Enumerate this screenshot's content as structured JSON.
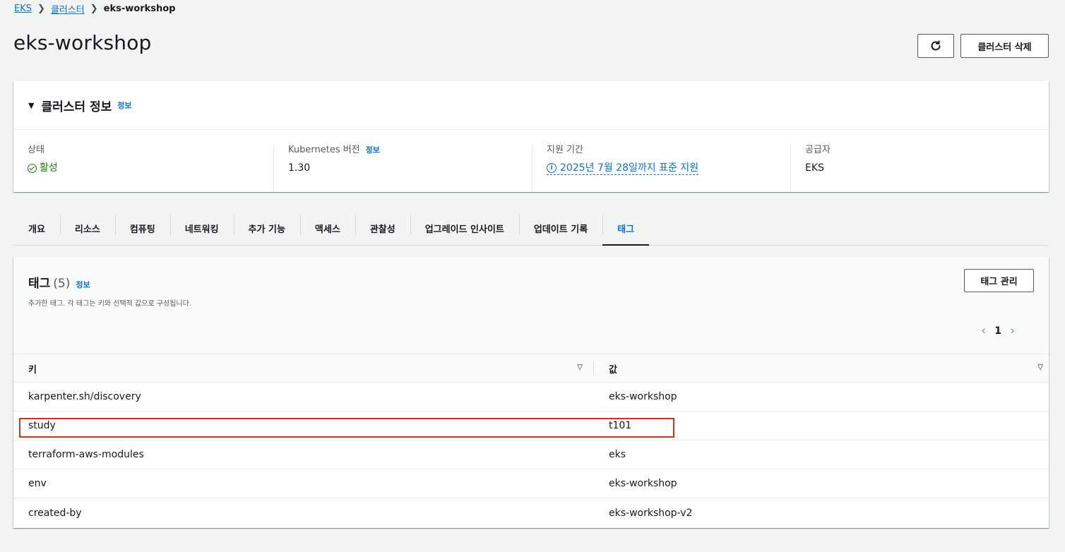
{
  "breadcrumb": {
    "items": [
      "EKS",
      "클러스터"
    ],
    "current": "eks-workshop"
  },
  "header": {
    "title": "eks-workshop",
    "delete_label": "클러스터 삭제"
  },
  "cluster_info": {
    "title": "클러스터 정보",
    "info_link": "정보",
    "status": {
      "label": "상태",
      "value": "활성"
    },
    "k8s_version": {
      "label": "Kubernetes 버전",
      "info_link": "정보",
      "value": "1.30"
    },
    "support": {
      "label": "지원 기간",
      "value": "2025년 7월 28일까지 표준 지원"
    },
    "provider": {
      "label": "공급자",
      "value": "EKS"
    }
  },
  "tabs": [
    "개요",
    "리소스",
    "컴퓨팅",
    "네트워킹",
    "추가 기능",
    "액세스",
    "관찰성",
    "업그레이드 인사이트",
    "업데이트 기록",
    "태그"
  ],
  "active_tab": "태그",
  "tags": {
    "title": "태그",
    "count": "(5)",
    "info_link": "정보",
    "description": "추가한 태그. 각 태그는 키와 선택적 값으로 구성됩니다.",
    "manage_label": "태그 관리",
    "page": "1",
    "columns": {
      "key": "키",
      "value": "값"
    },
    "rows": [
      {
        "key": "karpenter.sh/discovery",
        "value": "eks-workshop"
      },
      {
        "key": "study",
        "value": "t101"
      },
      {
        "key": "terraform-aws-modules",
        "value": "eks"
      },
      {
        "key": "env",
        "value": "eks-workshop"
      },
      {
        "key": "created-by",
        "value": "eks-workshop-v2"
      }
    ]
  },
  "colors": {
    "accent": "#0972d3",
    "status_ok": "#1d8102",
    "highlight": "#d13212"
  }
}
